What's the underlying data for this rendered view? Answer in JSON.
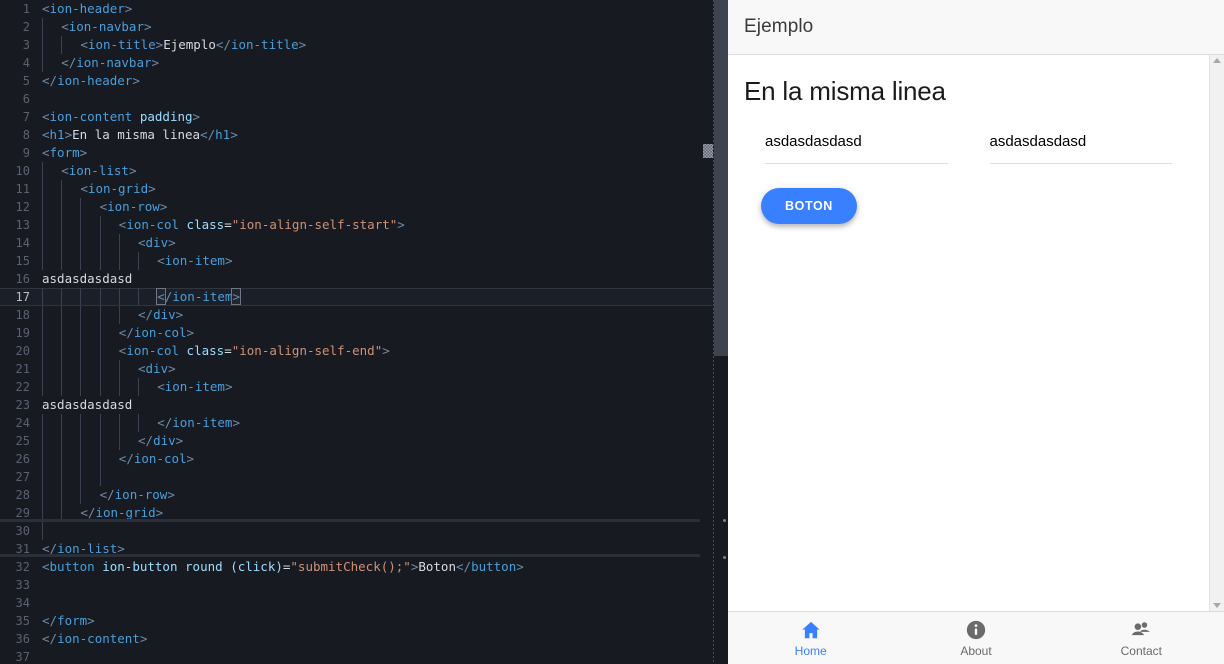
{
  "editor": {
    "language": "html",
    "active_line": 17,
    "lines": [
      {
        "n": 1,
        "indent": 0,
        "tokens": [
          {
            "t": "punct",
            "v": "<"
          },
          {
            "t": "tag",
            "v": "ion-header"
          },
          {
            "t": "punct",
            "v": ">"
          }
        ]
      },
      {
        "n": 2,
        "indent": 1,
        "tokens": [
          {
            "t": "punct",
            "v": "<"
          },
          {
            "t": "tag",
            "v": "ion-navbar"
          },
          {
            "t": "punct",
            "v": ">"
          }
        ]
      },
      {
        "n": 3,
        "indent": 2,
        "tokens": [
          {
            "t": "punct",
            "v": "<"
          },
          {
            "t": "tag",
            "v": "ion-title"
          },
          {
            "t": "punct",
            "v": ">"
          },
          {
            "t": "plain",
            "v": "Ejemplo"
          },
          {
            "t": "punct",
            "v": "</"
          },
          {
            "t": "tag",
            "v": "ion-title"
          },
          {
            "t": "punct",
            "v": ">"
          }
        ]
      },
      {
        "n": 4,
        "indent": 1,
        "tokens": [
          {
            "t": "punct",
            "v": "</"
          },
          {
            "t": "tag",
            "v": "ion-navbar"
          },
          {
            "t": "punct",
            "v": ">"
          }
        ]
      },
      {
        "n": 5,
        "indent": 0,
        "tokens": [
          {
            "t": "punct",
            "v": "</"
          },
          {
            "t": "tag",
            "v": "ion-header"
          },
          {
            "t": "punct",
            "v": ">"
          }
        ]
      },
      {
        "n": 6,
        "indent": 0,
        "tokens": []
      },
      {
        "n": 7,
        "indent": 0,
        "tokens": [
          {
            "t": "punct",
            "v": "<"
          },
          {
            "t": "tag",
            "v": "ion-content"
          },
          {
            "t": "plain",
            "v": " "
          },
          {
            "t": "attr",
            "v": "padding"
          },
          {
            "t": "punct",
            "v": ">"
          }
        ]
      },
      {
        "n": 8,
        "indent": 0,
        "tokens": [
          {
            "t": "punct",
            "v": "<"
          },
          {
            "t": "tag",
            "v": "h1"
          },
          {
            "t": "punct",
            "v": ">"
          },
          {
            "t": "plain",
            "v": "En la misma linea"
          },
          {
            "t": "punct",
            "v": "</"
          },
          {
            "t": "tag",
            "v": "h1"
          },
          {
            "t": "punct",
            "v": ">"
          }
        ]
      },
      {
        "n": 9,
        "indent": 0,
        "tokens": [
          {
            "t": "punct",
            "v": "<"
          },
          {
            "t": "tag",
            "v": "form"
          },
          {
            "t": "punct",
            "v": ">"
          }
        ]
      },
      {
        "n": 10,
        "indent": 1,
        "tokens": [
          {
            "t": "punct",
            "v": "<"
          },
          {
            "t": "tag",
            "v": "ion-list"
          },
          {
            "t": "punct",
            "v": ">"
          }
        ]
      },
      {
        "n": 11,
        "indent": 2,
        "tokens": [
          {
            "t": "punct",
            "v": "<"
          },
          {
            "t": "tag",
            "v": "ion-grid"
          },
          {
            "t": "punct",
            "v": ">"
          }
        ]
      },
      {
        "n": 12,
        "indent": 3,
        "tokens": [
          {
            "t": "punct",
            "v": "<"
          },
          {
            "t": "tag",
            "v": "ion-row"
          },
          {
            "t": "punct",
            "v": ">"
          }
        ]
      },
      {
        "n": 13,
        "indent": 4,
        "tokens": [
          {
            "t": "punct",
            "v": "<"
          },
          {
            "t": "tag",
            "v": "ion-col"
          },
          {
            "t": "plain",
            "v": " "
          },
          {
            "t": "attr",
            "v": "class"
          },
          {
            "t": "eq",
            "v": "="
          },
          {
            "t": "str",
            "v": "\"ion-align-self-start\""
          },
          {
            "t": "punct",
            "v": ">"
          }
        ]
      },
      {
        "n": 14,
        "indent": 5,
        "tokens": [
          {
            "t": "punct",
            "v": "<"
          },
          {
            "t": "tag",
            "v": "div"
          },
          {
            "t": "punct",
            "v": ">"
          }
        ]
      },
      {
        "n": 15,
        "indent": 6,
        "tokens": [
          {
            "t": "punct",
            "v": "<"
          },
          {
            "t": "tag",
            "v": "ion-item"
          },
          {
            "t": "punct",
            "v": ">"
          }
        ]
      },
      {
        "n": 16,
        "indent": 0,
        "tokens": [
          {
            "t": "plain",
            "v": "asdasdasdasd"
          }
        ]
      },
      {
        "n": 17,
        "indent": 6,
        "tokens": [
          {
            "t": "bracket",
            "v": "<"
          },
          {
            "t": "punct",
            "v": "/"
          },
          {
            "t": "tag",
            "v": "ion-item"
          },
          {
            "t": "bracket",
            "v": ">"
          }
        ]
      },
      {
        "n": 18,
        "indent": 5,
        "tokens": [
          {
            "t": "punct",
            "v": "</"
          },
          {
            "t": "tag",
            "v": "div"
          },
          {
            "t": "punct",
            "v": ">"
          }
        ]
      },
      {
        "n": 19,
        "indent": 4,
        "tokens": [
          {
            "t": "punct",
            "v": "</"
          },
          {
            "t": "tag",
            "v": "ion-col"
          },
          {
            "t": "punct",
            "v": ">"
          }
        ]
      },
      {
        "n": 20,
        "indent": 4,
        "tokens": [
          {
            "t": "punct",
            "v": "<"
          },
          {
            "t": "tag",
            "v": "ion-col"
          },
          {
            "t": "plain",
            "v": " "
          },
          {
            "t": "attr",
            "v": "class"
          },
          {
            "t": "eq",
            "v": "="
          },
          {
            "t": "str",
            "v": "\"ion-align-self-end\""
          },
          {
            "t": "punct",
            "v": ">"
          }
        ]
      },
      {
        "n": 21,
        "indent": 5,
        "tokens": [
          {
            "t": "punct",
            "v": "<"
          },
          {
            "t": "tag",
            "v": "div"
          },
          {
            "t": "punct",
            "v": ">"
          }
        ]
      },
      {
        "n": 22,
        "indent": 6,
        "tokens": [
          {
            "t": "punct",
            "v": "<"
          },
          {
            "t": "tag",
            "v": "ion-item"
          },
          {
            "t": "punct",
            "v": ">"
          }
        ]
      },
      {
        "n": 23,
        "indent": 0,
        "tokens": [
          {
            "t": "plain",
            "v": "asdasdasdasd"
          }
        ]
      },
      {
        "n": 24,
        "indent": 6,
        "tokens": [
          {
            "t": "punct",
            "v": "</"
          },
          {
            "t": "tag",
            "v": "ion-item"
          },
          {
            "t": "punct",
            "v": ">"
          }
        ]
      },
      {
        "n": 25,
        "indent": 5,
        "tokens": [
          {
            "t": "punct",
            "v": "</"
          },
          {
            "t": "tag",
            "v": "div"
          },
          {
            "t": "punct",
            "v": ">"
          }
        ]
      },
      {
        "n": 26,
        "indent": 4,
        "tokens": [
          {
            "t": "punct",
            "v": "</"
          },
          {
            "t": "tag",
            "v": "ion-col"
          },
          {
            "t": "punct",
            "v": ">"
          }
        ]
      },
      {
        "n": 27,
        "indent": 4,
        "tokens": []
      },
      {
        "n": 28,
        "indent": 3,
        "tokens": [
          {
            "t": "punct",
            "v": "</"
          },
          {
            "t": "tag",
            "v": "ion-row"
          },
          {
            "t": "punct",
            "v": ">"
          }
        ]
      },
      {
        "n": 29,
        "indent": 2,
        "tokens": [
          {
            "t": "punct",
            "v": "</"
          },
          {
            "t": "tag",
            "v": "ion-grid"
          },
          {
            "t": "punct",
            "v": ">"
          }
        ]
      },
      {
        "n": 30,
        "indent": 1,
        "tokens": []
      },
      {
        "n": 31,
        "indent": 0,
        "tokens": [
          {
            "t": "punct",
            "v": "</"
          },
          {
            "t": "tag",
            "v": "ion-list"
          },
          {
            "t": "punct",
            "v": ">"
          }
        ]
      },
      {
        "n": 32,
        "indent": 0,
        "tokens": [
          {
            "t": "punct",
            "v": "<"
          },
          {
            "t": "tag",
            "v": "button"
          },
          {
            "t": "plain",
            "v": " "
          },
          {
            "t": "attr",
            "v": "ion-button"
          },
          {
            "t": "plain",
            "v": " "
          },
          {
            "t": "attr",
            "v": "round"
          },
          {
            "t": "plain",
            "v": " "
          },
          {
            "t": "attr",
            "v": "(click)"
          },
          {
            "t": "eq",
            "v": "="
          },
          {
            "t": "str",
            "v": "\"submitCheck();\""
          },
          {
            "t": "punct",
            "v": ">"
          },
          {
            "t": "plain",
            "v": "Boton"
          },
          {
            "t": "punct",
            "v": "</"
          },
          {
            "t": "tag",
            "v": "button"
          },
          {
            "t": "punct",
            "v": ">"
          }
        ]
      },
      {
        "n": 33,
        "indent": 0,
        "tokens": []
      },
      {
        "n": 34,
        "indent": 0,
        "tokens": []
      },
      {
        "n": 35,
        "indent": 0,
        "tokens": [
          {
            "t": "punct",
            "v": "</"
          },
          {
            "t": "tag",
            "v": "form"
          },
          {
            "t": "punct",
            "v": ">"
          }
        ]
      },
      {
        "n": 36,
        "indent": 0,
        "tokens": [
          {
            "t": "punct",
            "v": "</"
          },
          {
            "t": "tag",
            "v": "ion-content"
          },
          {
            "t": "punct",
            "v": ">"
          }
        ]
      },
      {
        "n": 37,
        "indent": 0,
        "tokens": []
      }
    ]
  },
  "preview": {
    "toolbar": {
      "title": "Ejemplo"
    },
    "heading": "En la misma linea",
    "columns": [
      {
        "item_text": "asdasdasdasd"
      },
      {
        "item_text": "asdasdasdasd"
      }
    ],
    "button": {
      "label": "BOTON",
      "color": "#3880ff"
    },
    "tabs": [
      {
        "label": "Home",
        "icon": "home-icon",
        "active": true
      },
      {
        "label": "About",
        "icon": "info-icon",
        "active": false
      },
      {
        "label": "Contact",
        "icon": "people-icon",
        "active": false
      }
    ],
    "scrollbar": {
      "up": "▲",
      "down": "▼"
    }
  }
}
